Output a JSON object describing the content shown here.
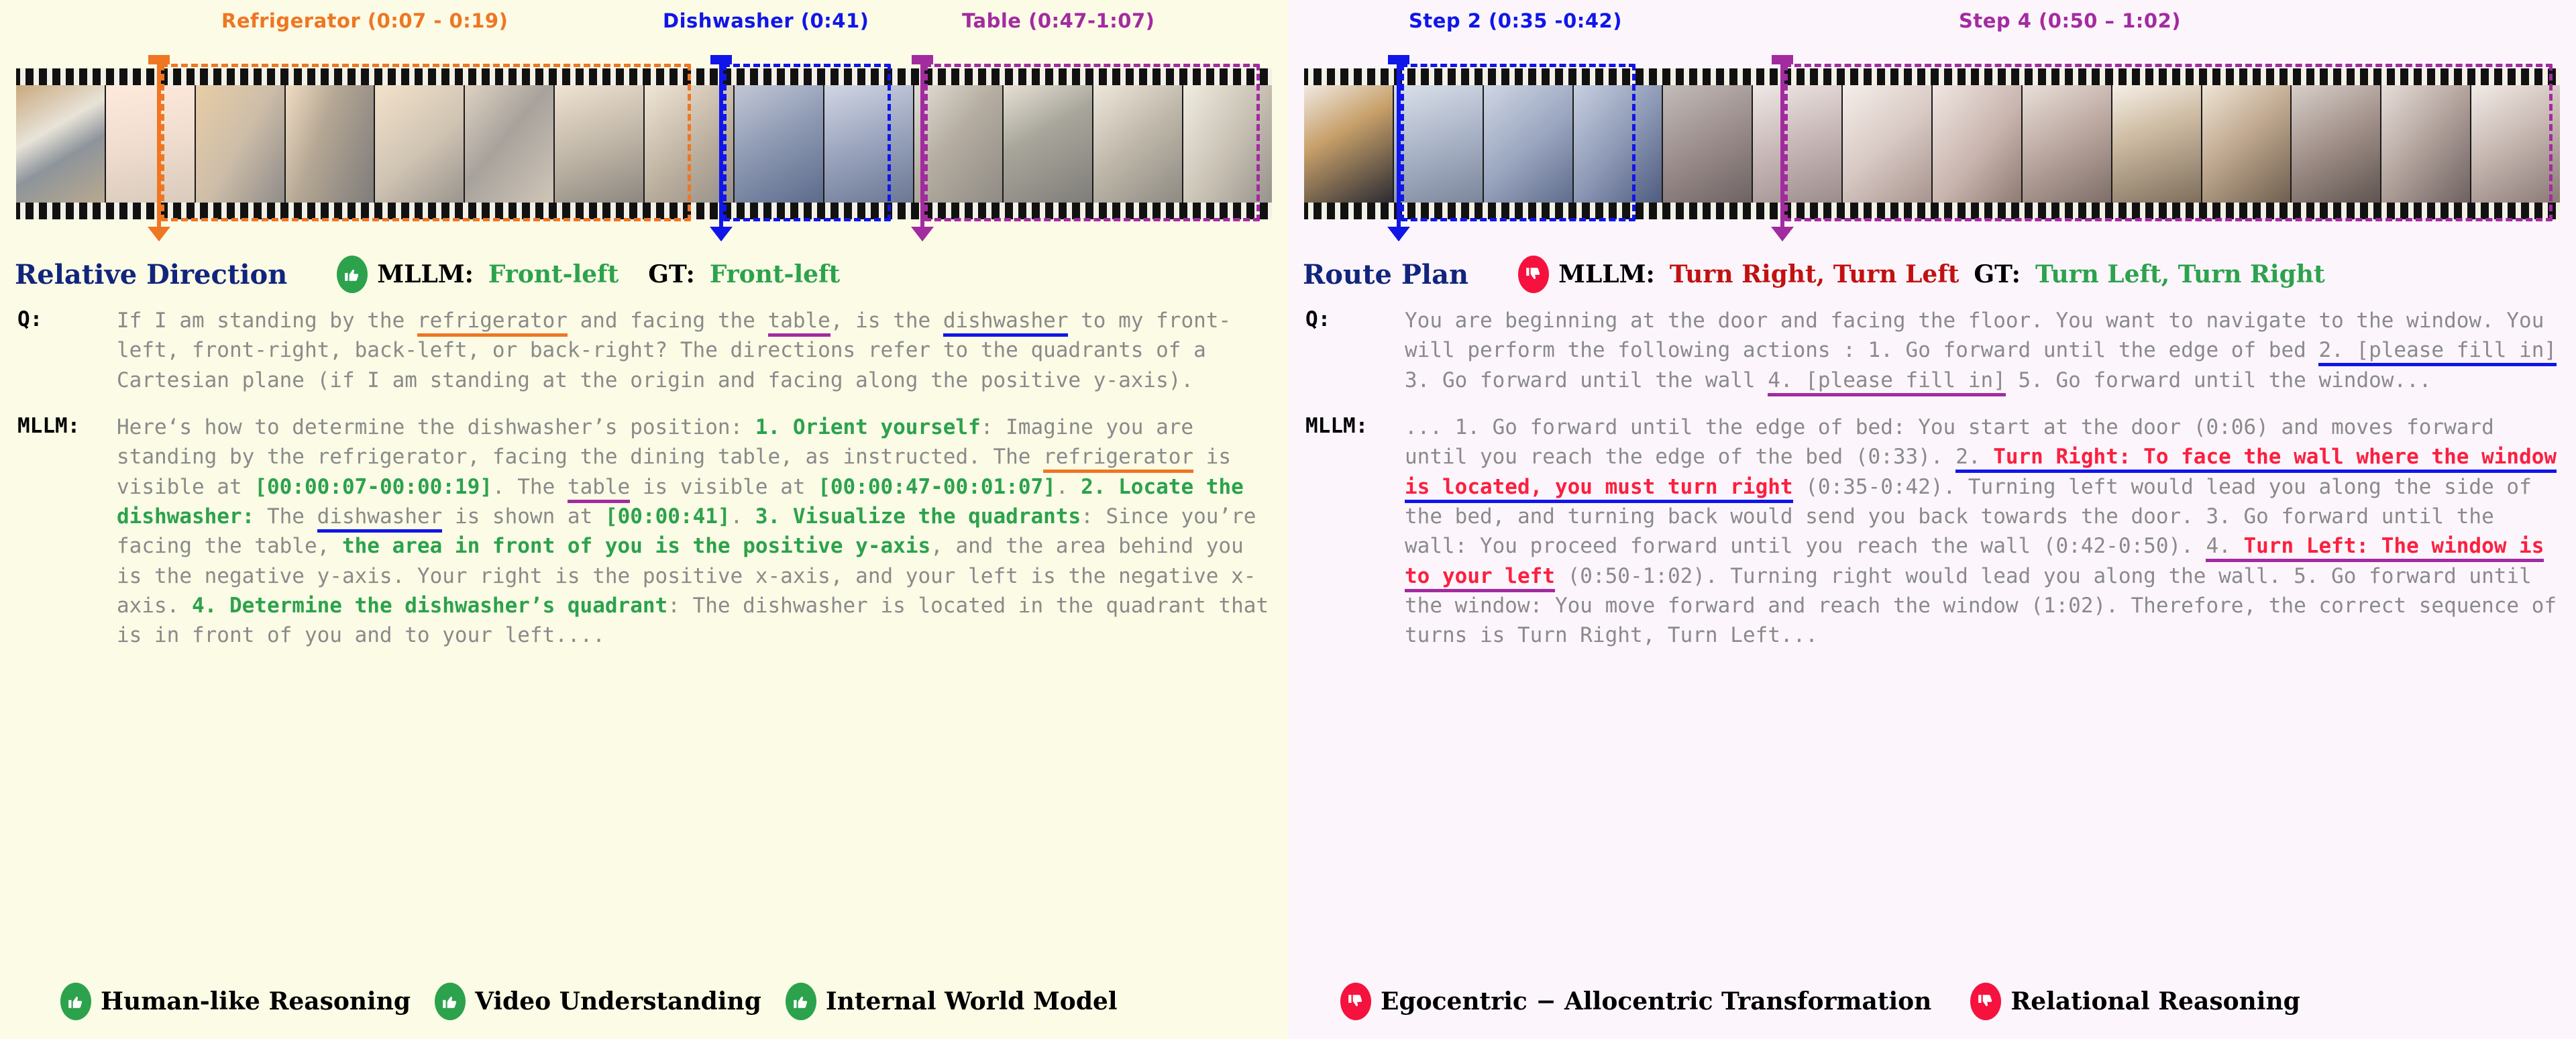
{
  "left": {
    "panel_bg": "#fbfbe6",
    "timeline": {
      "segments": [
        {
          "label": "Refrigerator (0:07 - 0:19)",
          "color": "#ef7622"
        },
        {
          "label": "Dishwasher (0:41)",
          "color": "#1016e8"
        },
        {
          "label": "Table (0:47-1:07)",
          "color": "#a32ba0"
        }
      ]
    },
    "category": "Relative Direction",
    "verdict": {
      "icon": "thumbs-up-icon",
      "mllm_label": "MLLM:",
      "mllm_value": "Front-left",
      "gt_label": "GT:",
      "gt_value": "Front-left"
    },
    "q_tag": "Q:",
    "mllm_tag": "MLLM:",
    "question": {
      "p1": "If I am standing by the ",
      "ref": "refrigerator",
      "p2": " and facing the ",
      "table": "table",
      "p3": ", is the ",
      "dish": "dishwasher",
      "p4": " to my front-left, front-right, back-left, or back-right? The directions refer to the quadrants of a Cartesian plane (if I am standing at the origin and facing along the positive y-axis)."
    },
    "answer": {
      "a1": "Here‘s how to determine the dishwasher’s position: ",
      "h1": "1. Orient yourself",
      "a2": ": Imagine you are standing by the refrigerator, facing the dining table, as instructed. The ",
      "ref": "refrigerator",
      "a3": " is visible at ",
      "t1": "[00:00:07-00:00:19]",
      "a4": ". The ",
      "table": "table",
      "a5": " is visible at ",
      "t2": "[00:00:47-00:01:07]",
      "a6": ". ",
      "h2": "2. Locate the dishwasher:",
      "a7": " The ",
      "dish": "dishwasher",
      "a8": " is shown at ",
      "t3": "[00:00:41]",
      "a9": ". ",
      "h3": "3. Visualize the quadrants",
      "a10": ": Since you’re facing the table, ",
      "h4": "the area in front of you is the positive y-axis",
      "a11": ", and the area behind you is the negative y-axis. Your right is the positive x-axis, and your left is the negative x-axis. ",
      "h5": "4. Determine the dishwasher’s quadrant",
      "a12": ": The dishwasher is located in the quadrant that is in front of you and to your left...."
    },
    "footer_tags": [
      {
        "icon": "thumbs-up-icon",
        "label": "Human-like Reasoning"
      },
      {
        "icon": "thumbs-up-icon",
        "label": "Video Understanding"
      },
      {
        "icon": "thumbs-up-icon",
        "label": "Internal World Model"
      }
    ]
  },
  "right": {
    "panel_bg": "#fcf6fc",
    "timeline": {
      "segments": [
        {
          "label": "Step 2 (0:35 -0:42)",
          "color": "#1016e8"
        },
        {
          "label": "Step 4 (0:50 – 1:02)",
          "color": "#a32ba0"
        }
      ]
    },
    "category": "Route Plan",
    "verdict": {
      "icon": "thumbs-down-icon",
      "mllm_label": "MLLM:",
      "mllm_value": "Turn Right, Turn Left",
      "gt_label": "GT:",
      "gt_value": "Turn Left, Turn Right"
    },
    "q_tag": "Q:",
    "mllm_tag": "MLLM:",
    "question": {
      "q1": "You are beginning at the door and facing the floor. You want to navigate to the window. You will perform the following actions : 1. Go forward until the edge of bed ",
      "blank1": "2. [please fill in]",
      "q2": " 3. Go forward until the wall ",
      "blank2": "4. [please fill in]",
      "q3": " 5. Go forward until the window..."
    },
    "answer": {
      "a1": "... 1. Go forward until the edge of bed: You start at the door (0:06) and moves forward until you reach the edge of the bed (0:33). ",
      "n2": "2.",
      "r1": " Turn Right: To face the wall where the window is located, you must turn right",
      "a2": " (0:35-0:42). Turning left would lead you along the side of the bed, and turning back would send you back towards the door. 3. Go forward until the wall: You proceed forward until you reach the wall (0:42-0:50). ",
      "n4": "4.",
      "r2": " Turn Left: The window is to your left",
      "a3": " (0:50-1:02). Turning right would lead you along the wall. 5. Go forward until the window: You move forward and reach the window (1:02). Therefore, the correct sequence of turns is Turn Right, Turn Left..."
    },
    "footer_tags": [
      {
        "icon": "thumbs-down-icon",
        "label": "Egocentric − Allocentric Transformation"
      },
      {
        "icon": "thumbs-down-icon",
        "label": "Relational Reasoning"
      }
    ]
  },
  "icons": {
    "thumbs_up": "👍",
    "thumbs_down": "👎"
  }
}
